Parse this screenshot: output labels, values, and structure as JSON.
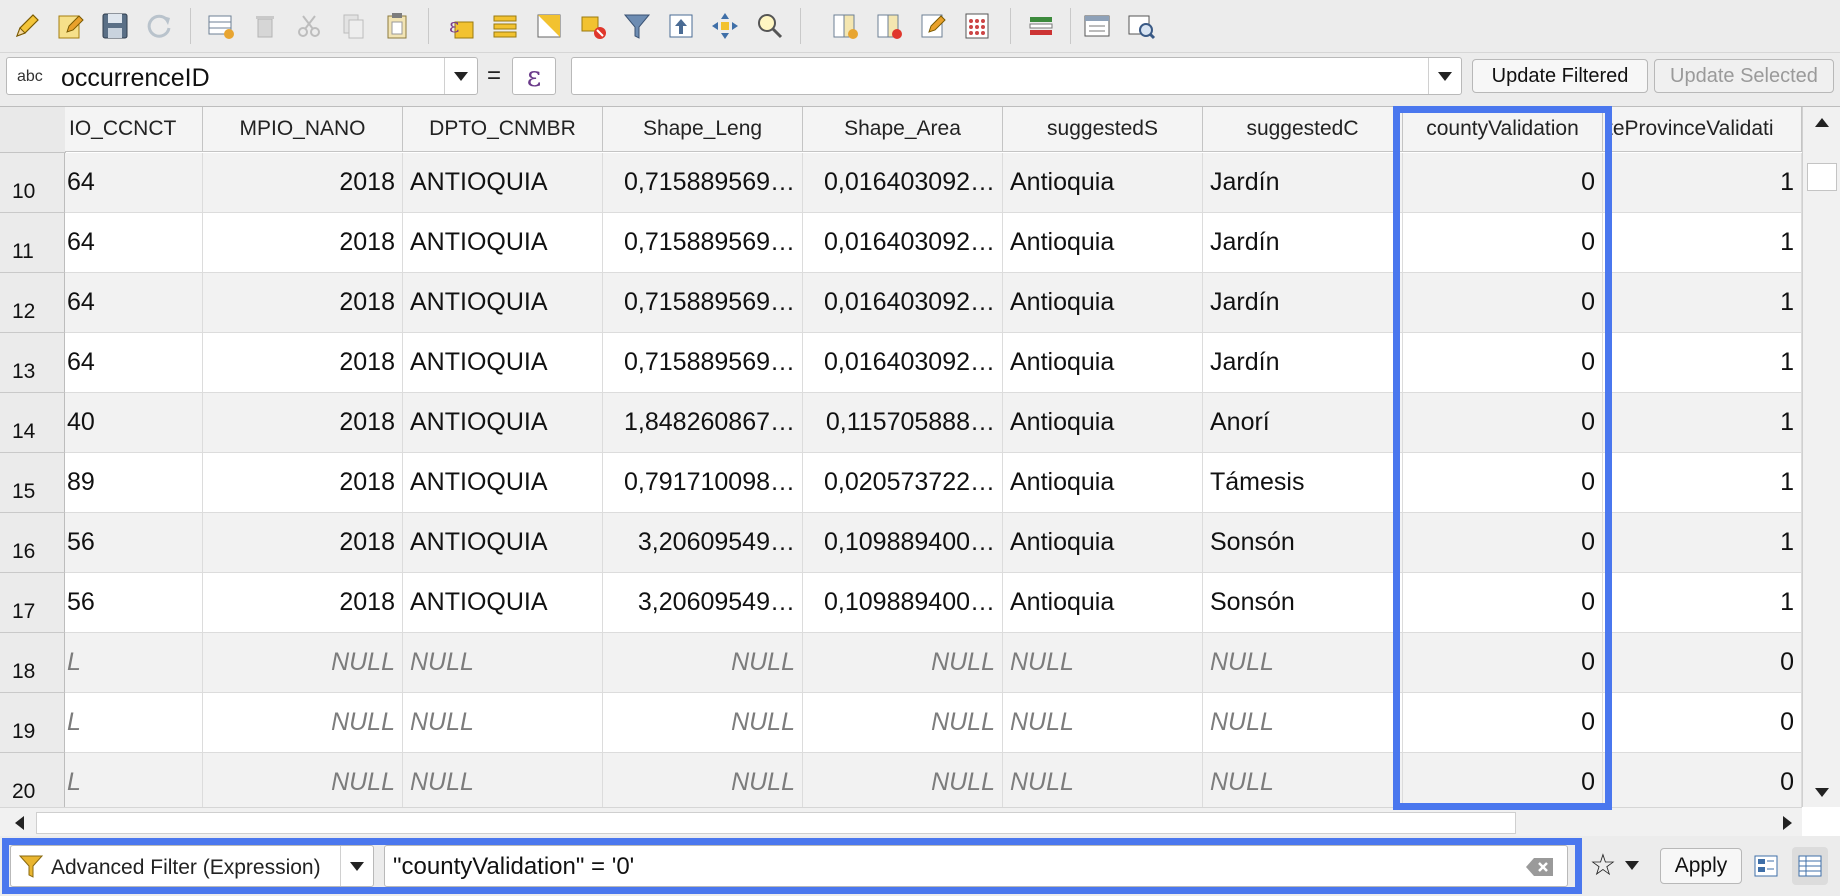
{
  "toolbar": {
    "buttons": [
      "toggle-editing-icon",
      "multi-edit-icon",
      "save-edits-icon",
      "reload-icon",
      "add-feature-icon",
      "delete-feature-icon",
      "cut-icon",
      "copy-icon",
      "paste-icon",
      "select-expression-icon",
      "select-all-icon",
      "invert-selection-icon",
      "deselect-all-icon",
      "filter-icon",
      "move-selection-top-icon",
      "pan-to-selected-icon",
      "zoom-to-selected-icon",
      "new-field-icon",
      "delete-field-icon",
      "conditional-format-icon",
      "field-calculator-icon",
      "actions-icon",
      "dock-table-icon",
      "organize-columns-icon"
    ]
  },
  "field_calc": {
    "type_tag": "abc",
    "field_name": "occurrenceID",
    "equals": "=",
    "epsilon": "ε",
    "expression_value": "",
    "update_filtered": "Update Filtered",
    "update_selected": "Update Selected"
  },
  "table": {
    "columns": [
      "IO_CCNCT",
      "MPIO_NANO",
      "DPTO_CNMBR",
      "Shape_Leng",
      "Shape_Area",
      "suggestedS",
      "suggestedC",
      "countyValidation",
      "teProvinceValidati"
    ],
    "rows": [
      {
        "n": "10",
        "c": [
          "64",
          "2018",
          "ANTIOQUIA",
          "0,715889569…",
          "0,016403092…",
          "Antioquia",
          "Jardín",
          "0",
          "1"
        ]
      },
      {
        "n": "11",
        "c": [
          "64",
          "2018",
          "ANTIOQUIA",
          "0,715889569…",
          "0,016403092…",
          "Antioquia",
          "Jardín",
          "0",
          "1"
        ]
      },
      {
        "n": "12",
        "c": [
          "64",
          "2018",
          "ANTIOQUIA",
          "0,715889569…",
          "0,016403092…",
          "Antioquia",
          "Jardín",
          "0",
          "1"
        ]
      },
      {
        "n": "13",
        "c": [
          "64",
          "2018",
          "ANTIOQUIA",
          "0,715889569…",
          "0,016403092…",
          "Antioquia",
          "Jardín",
          "0",
          "1"
        ]
      },
      {
        "n": "14",
        "c": [
          "40",
          "2018",
          "ANTIOQUIA",
          "1,848260867…",
          "0,115705888…",
          "Antioquia",
          "Anorí",
          "0",
          "1"
        ]
      },
      {
        "n": "15",
        "c": [
          "89",
          "2018",
          "ANTIOQUIA",
          "0,791710098…",
          "0,020573722…",
          "Antioquia",
          "Támesis",
          "0",
          "1"
        ]
      },
      {
        "n": "16",
        "c": [
          "56",
          "2018",
          "ANTIOQUIA",
          "3,20609549…",
          "0,109889400…",
          "Antioquia",
          "Sonsón",
          "0",
          "1"
        ]
      },
      {
        "n": "17",
        "c": [
          "56",
          "2018",
          "ANTIOQUIA",
          "3,20609549…",
          "0,109889400…",
          "Antioquia",
          "Sonsón",
          "0",
          "1"
        ]
      },
      {
        "n": "18",
        "c": [
          "L",
          "NULL",
          "NULL",
          "NULL",
          "NULL",
          "NULL",
          "NULL",
          "0",
          "0"
        ]
      },
      {
        "n": "19",
        "c": [
          "L",
          "NULL",
          "NULL",
          "NULL",
          "NULL",
          "NULL",
          "NULL",
          "0",
          "0"
        ]
      },
      {
        "n": "20",
        "c": [
          "L",
          "NULL",
          "NULL",
          "NULL",
          "NULL",
          "NULL",
          "NULL",
          "0",
          "0"
        ]
      }
    ]
  },
  "filter": {
    "mode_label": "Advanced Filter (Expression)",
    "expression": "\"countyValidation\" = '0'",
    "apply_label": "Apply",
    "star": "☆"
  },
  "colors": {
    "highlight": "#4a77ee",
    "null_text": "#7c7c7c"
  }
}
